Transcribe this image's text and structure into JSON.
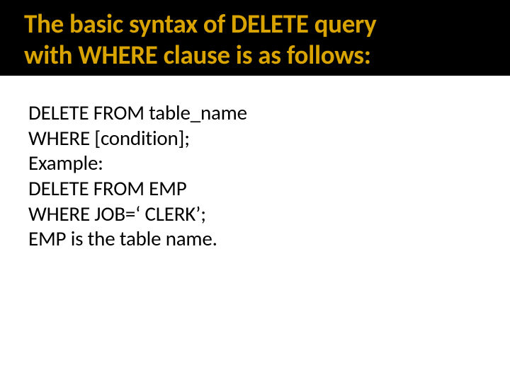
{
  "title": {
    "line1": "The basic syntax of DELETE query",
    "line2": "with WHERE clause is as follows:"
  },
  "body": {
    "line1": "DELETE FROM table_name",
    "line2": "WHERE [condition];",
    "line3": "Example:",
    "line4": "DELETE FROM EMP",
    "line5": "WHERE JOB=‘ CLERK’;",
    "line6": "EMP is the table name."
  }
}
